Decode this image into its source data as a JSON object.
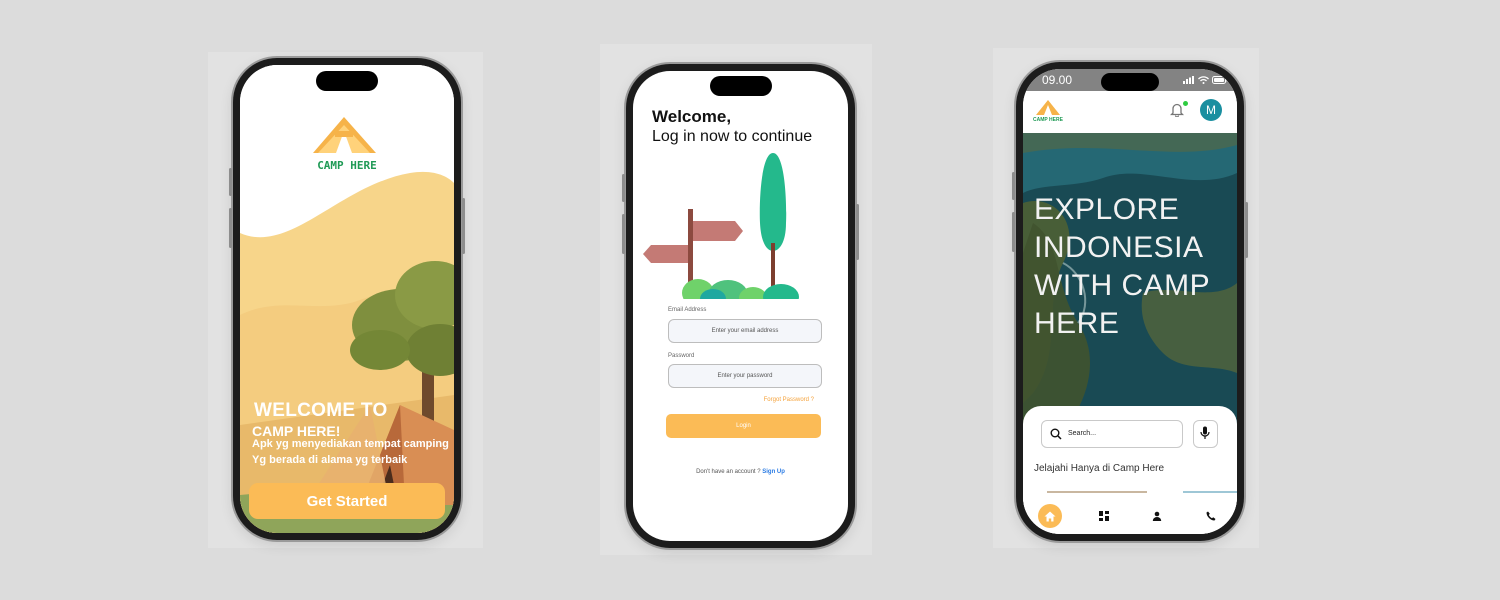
{
  "onboarding": {
    "logo_text": "CAMP HERE",
    "title": "WELCOME TO",
    "subtitle": "CAMP HERE!",
    "description_line1": "Apk yg menyediakan tempat camping",
    "description_line2": "Yg berada  di alama yg terbaik",
    "cta_label": "Get Started"
  },
  "login": {
    "heading": "Welcome,",
    "subheading": "Log in now to continue",
    "email_label": "Email Address",
    "email_placeholder": "Enter your email address",
    "password_label": "Password",
    "password_placeholder": "Enter your password",
    "forgot_label": "Forgot Password ?",
    "login_label": "Login",
    "no_account_text": "Don't have an account ?",
    "signup_label": "Sign Up"
  },
  "home": {
    "status_time": "09.00",
    "logo_text": "CAMP HERE",
    "avatar_initial": "M",
    "hero_line1": "EXPLORE",
    "hero_line2": "INDONESIA",
    "hero_line3": "WITH CAMP",
    "hero_line4": "HERE",
    "search_placeholder": "Search...",
    "caption": "Jelajahi Hanya di Camp Here",
    "nav": [
      "home-icon",
      "dashboard-icon",
      "user-icon",
      "phone-icon"
    ]
  },
  "colors": {
    "accent": "#fbbb56",
    "green": "#24b98c",
    "logo_green": "#1f9a55",
    "link_blue": "#2a7be4"
  }
}
